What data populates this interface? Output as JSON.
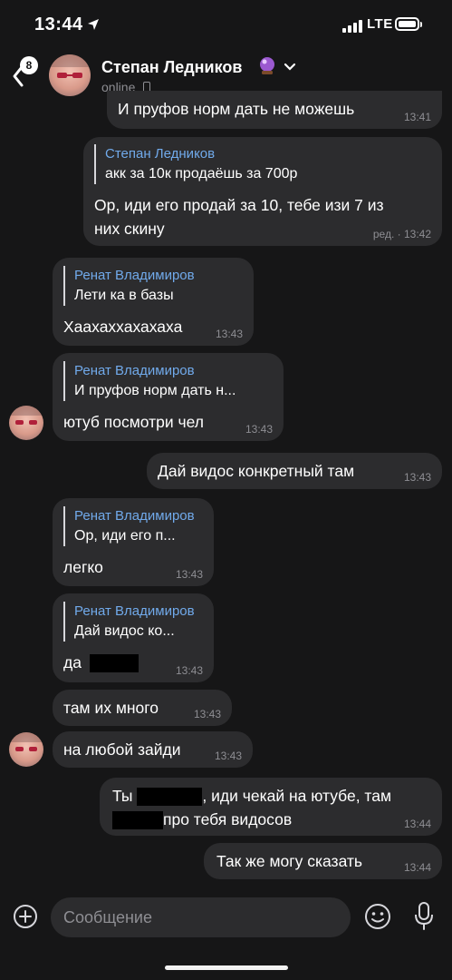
{
  "status_bar": {
    "time": "13:44",
    "network": "LTE"
  },
  "header": {
    "unread_count": "8",
    "name": "Степан Ледников",
    "status": "online"
  },
  "messages": [
    {
      "text": "И пруфов норм дать не можешь",
      "time": "13:41"
    },
    {
      "reply_author": "Степан Ледников",
      "reply_text": "акк за 10к продаёшь за 700р",
      "text_line1": "Ор, иди его продай за 10, тебе изи 7 из",
      "text_line2": "них скину",
      "edited": "ред. ·",
      "time": "13:42"
    },
    {
      "reply_author": "Ренат Владимиров",
      "reply_text": "Лети ка в базы",
      "text": "Хаахаххахахаха",
      "time": "13:43"
    },
    {
      "reply_author": "Ренат Владимиров",
      "reply_text": "И пруфов норм дать н...",
      "text": "ютуб посмотри чел",
      "time": "13:43"
    },
    {
      "text": "Дай видос конкретный там",
      "time": "13:43"
    },
    {
      "reply_author": "Ренат Владимиров",
      "reply_text": "Ор, иди его п...",
      "text": "легко",
      "time": "13:43"
    },
    {
      "reply_author": "Ренат Владимиров",
      "reply_text": "Дай видос ко...",
      "text": "да",
      "time": "13:43"
    },
    {
      "text": "там их много",
      "time": "13:43"
    },
    {
      "text": "на любой зайди",
      "time": "13:43"
    },
    {
      "text_a": "Ты",
      "text_b": ", иди чекай на ютубе, там",
      "text_c": "про тебя видосов",
      "time": "13:44"
    },
    {
      "text": "Так же могу сказать",
      "time": "13:44"
    }
  ],
  "composer": {
    "placeholder": "Сообщение"
  }
}
